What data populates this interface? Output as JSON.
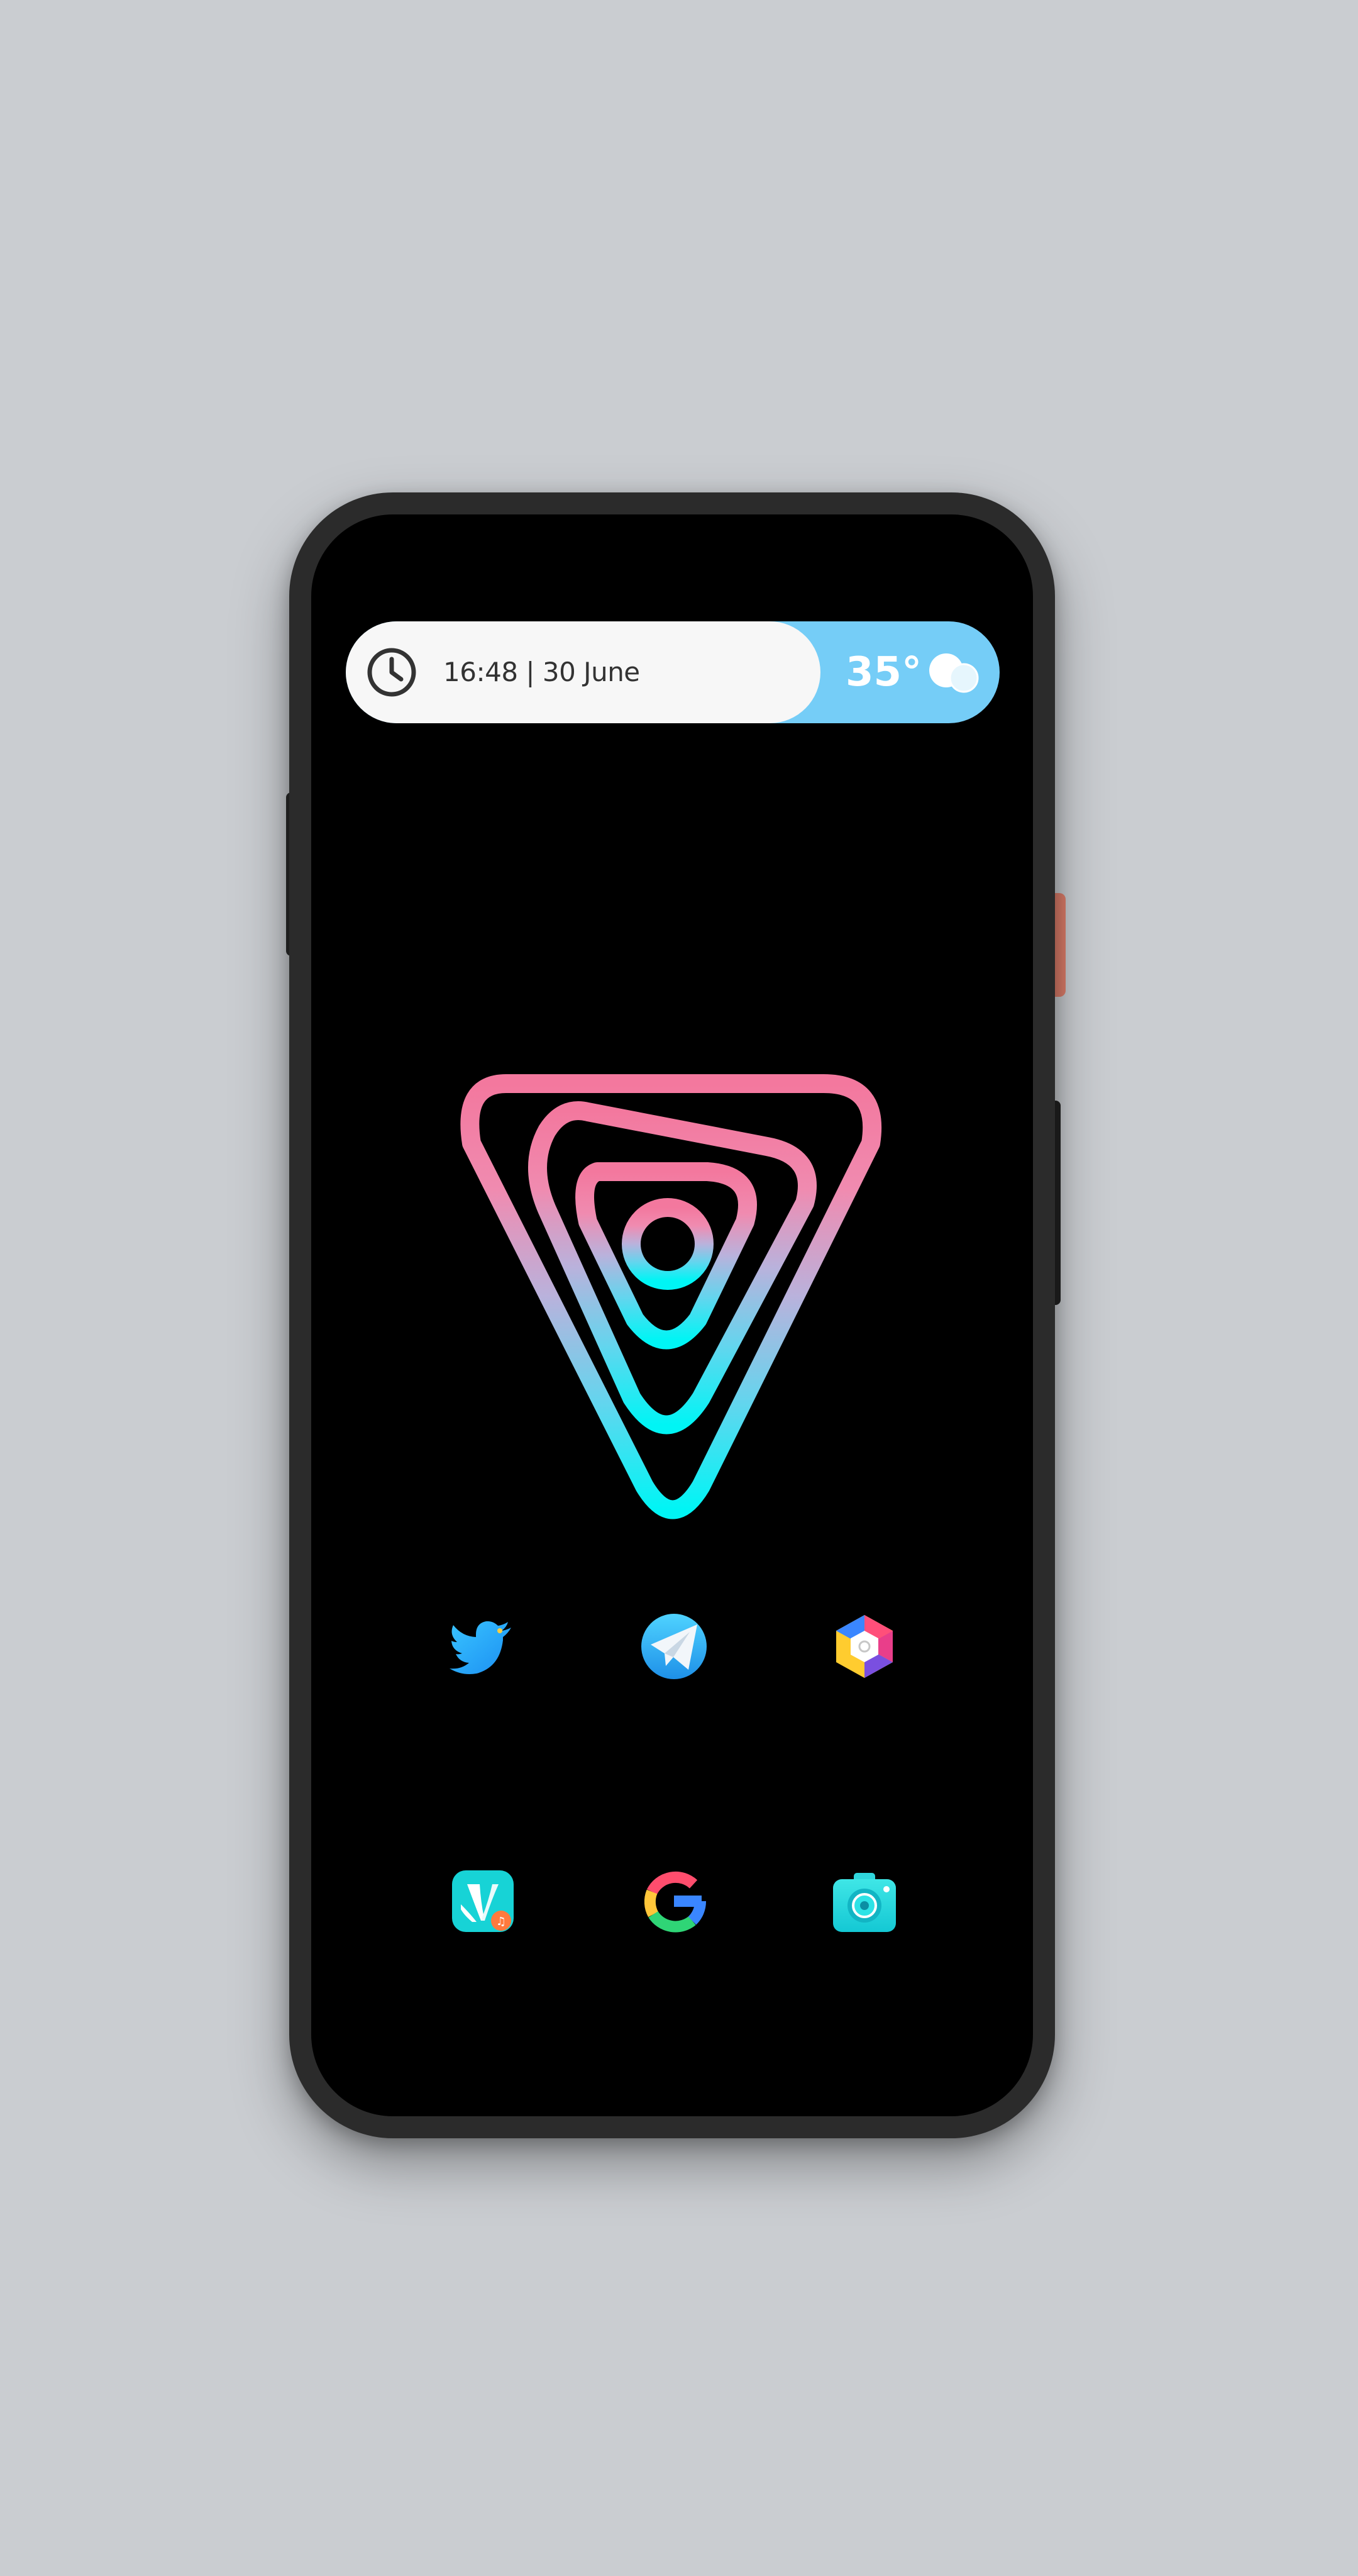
{
  "widget": {
    "time_date": "16:48 | 30 June",
    "temperature": "35°",
    "clock_icon": "clock-icon",
    "weather_icon": "partly-cloudy-icon"
  },
  "home_logo": "gradient-triangle-logo",
  "apps": [
    {
      "icon": "twitter-icon"
    },
    {
      "icon": "telegram-icon"
    },
    {
      "icon": "hexagon-app-icon"
    },
    {
      "icon": "jiosaavn-icon"
    },
    {
      "icon": "google-icon"
    },
    {
      "icon": "camera-icon"
    }
  ],
  "colors": {
    "background": "#cacdd1",
    "screen": "#000000",
    "widget_light": "#f7f7f7",
    "widget_accent": "#75cdf7",
    "gradient_pink": "#f3789e",
    "gradient_cyan": "#00f5f5"
  }
}
